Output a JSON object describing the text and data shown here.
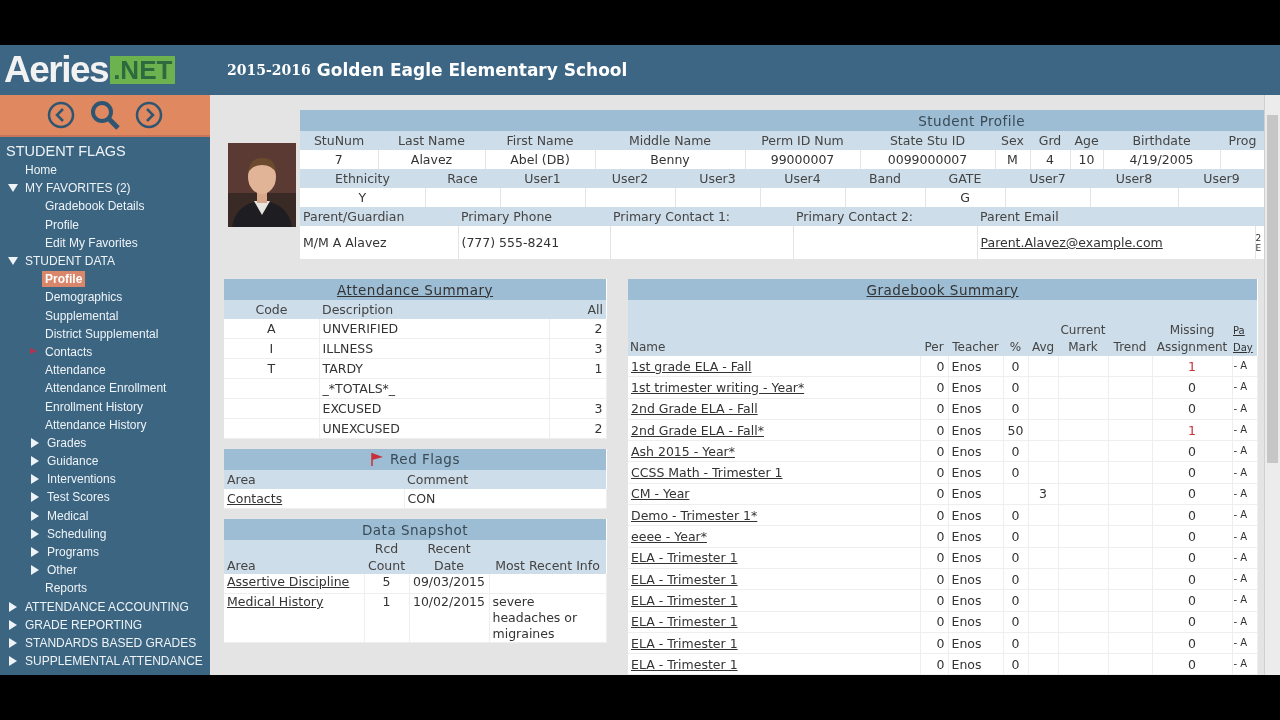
{
  "header": {
    "logo": {
      "name": "Aeries",
      "suffix": ".NET"
    },
    "year": "2015-2016",
    "school": "Golden Eagle Elementary School"
  },
  "sidebar": {
    "title": "STUDENT FLAGS",
    "items": [
      {
        "label": "Home",
        "selected": false
      },
      {
        "label": "MY FAVORITES (2)",
        "selected": false,
        "expanded": true,
        "children": [
          {
            "label": "Gradebook Details",
            "selected": false
          },
          {
            "label": "Profile",
            "selected": false
          },
          {
            "label": "Edit My Favorites",
            "selected": false
          }
        ]
      },
      {
        "label": "STUDENT DATA",
        "selected": false,
        "expanded": true,
        "children": [
          {
            "label": "Profile",
            "selected": true
          },
          {
            "label": "Demographics",
            "selected": false
          },
          {
            "label": "Supplemental",
            "selected": false
          },
          {
            "label": "District Supplemental",
            "selected": false
          },
          {
            "label": "Contacts",
            "selected": false,
            "flagged": true
          },
          {
            "label": "Attendance",
            "selected": false
          },
          {
            "label": "Attendance Enrollment",
            "selected": false
          },
          {
            "label": "Enrollment History",
            "selected": false
          },
          {
            "label": "Attendance History",
            "selected": false
          },
          {
            "label": "Grades",
            "selected": false,
            "expanded": false
          },
          {
            "label": "Guidance",
            "selected": false,
            "expanded": false
          },
          {
            "label": "Interventions",
            "selected": false,
            "expanded": false
          },
          {
            "label": "Test Scores",
            "selected": false,
            "expanded": false
          },
          {
            "label": "Medical",
            "selected": false,
            "expanded": false
          },
          {
            "label": "Scheduling",
            "selected": false,
            "expanded": false
          },
          {
            "label": "Programs",
            "selected": false,
            "expanded": false
          },
          {
            "label": "Other",
            "selected": false,
            "expanded": false
          },
          {
            "label": "Reports",
            "selected": false
          }
        ]
      },
      {
        "label": "ATTENDANCE ACCOUNTING",
        "selected": false,
        "expanded": false
      },
      {
        "label": "GRADE REPORTING",
        "selected": false,
        "expanded": false
      },
      {
        "label": "STANDARDS BASED GRADES",
        "selected": false,
        "expanded": false
      },
      {
        "label": "SUPPLEMENTAL ATTENDANCE",
        "selected": false,
        "expanded": false
      }
    ]
  },
  "profile": {
    "title": "Student Profile",
    "sections": [
      {
        "columns": [
          {
            "header": "StuNum",
            "value": "7"
          },
          {
            "header": "Last Name",
            "value": "Alavez"
          },
          {
            "header": "First Name",
            "value": "Abel (DB)"
          },
          {
            "header": "Middle Name",
            "value": "Benny"
          },
          {
            "header": "Perm ID Num",
            "value": "99000007"
          },
          {
            "header": "State Stu ID",
            "value": "0099000007"
          },
          {
            "header": "Sex",
            "value": "M"
          },
          {
            "header": "Grd",
            "value": "4"
          },
          {
            "header": "Age",
            "value": "10"
          },
          {
            "header": "Birthdate",
            "value": "4/19/2005"
          },
          {
            "header": "Prog"
          }
        ]
      },
      {
        "columns": [
          {
            "header": "Ethnicity",
            "value": "Y"
          },
          {
            "header": "Race"
          },
          {
            "header": "User1"
          },
          {
            "header": "User2"
          },
          {
            "header": "User3"
          },
          {
            "header": "User4"
          },
          {
            "header": "Band"
          },
          {
            "header": "GATE",
            "value": "G"
          },
          {
            "header": "User7"
          },
          {
            "header": "User8"
          },
          {
            "header": "User9"
          }
        ]
      },
      {
        "columns": [
          {
            "header": "Parent/Guardian",
            "value": "M/M A Alavez"
          },
          {
            "header": "Primary Phone",
            "value": "(777) 555-8241"
          },
          {
            "header": "Primary Contact 1:"
          },
          {
            "header": "Primary Contact 2:"
          },
          {
            "header": "Parent Email",
            "value": "Parent.Alavez@example.com"
          },
          {
            "value": "2 E"
          }
        ]
      }
    ]
  },
  "attendance": {
    "title": "Attendance Summary",
    "columns": [
      "Code",
      "Description",
      "All"
    ],
    "rows": [
      {
        "code": "A",
        "description": "UNVERIFIED",
        "all": "2"
      },
      {
        "code": "I",
        "description": "ILLNESS",
        "all": "3"
      },
      {
        "code": "T",
        "description": "TARDY",
        "all": "1"
      },
      {
        "description": "_*TOTALS*_"
      },
      {
        "description": "EXCUSED",
        "all": "3"
      },
      {
        "description": "UNEXCUSED",
        "all": "2"
      }
    ]
  },
  "red_flags": {
    "title": "Red Flags",
    "columns": [
      "Area",
      "Comment"
    ],
    "rows": [
      {
        "area": "Contacts",
        "comment": "CON"
      }
    ]
  },
  "snapshot": {
    "title": "Data Snapshot",
    "columns": [
      "Area",
      "Rcd Count",
      "Recent Date",
      "Most Recent Info"
    ],
    "rows": [
      {
        "area": "Assertive Discipline",
        "count": "5",
        "date": "09/03/2015"
      },
      {
        "area": "Medical History",
        "count": "1",
        "date": "10/02/2015",
        "info": "severe headaches or migraines"
      }
    ]
  },
  "gradebook": {
    "title": "Gradebook Summary",
    "columns": [
      "Name",
      "Per",
      "Teacher",
      "%",
      "Avg",
      "Current Mark",
      "Trend",
      "Missing Assignment",
      "Pa Day"
    ],
    "rows": [
      {
        "name": "1st grade ELA - Fall",
        "per": "0",
        "teacher": "Enos",
        "pct": "0",
        "missing": "1",
        "alert": true,
        "last": "- A"
      },
      {
        "name": "1st trimester writing - Year*",
        "per": "0",
        "teacher": "Enos",
        "pct": "0",
        "missing": "0",
        "alert": false,
        "last": "- A"
      },
      {
        "name": "2nd Grade ELA - Fall",
        "per": "0",
        "teacher": "Enos",
        "pct": "0",
        "missing": "0",
        "alert": false,
        "last": "- A"
      },
      {
        "name": "2nd Grade ELA - Fall*",
        "per": "0",
        "teacher": "Enos",
        "pct": "50",
        "missing": "1",
        "alert": true,
        "last": "- A"
      },
      {
        "name": "Ash 2015 - Year*",
        "per": "0",
        "teacher": "Enos",
        "pct": "0",
        "missing": "0",
        "alert": false,
        "last": "- A"
      },
      {
        "name": "CCSS Math - Trimester 1",
        "per": "0",
        "teacher": "Enos",
        "pct": "0",
        "missing": "0",
        "alert": false,
        "last": "- A"
      },
      {
        "name": "CM - Year",
        "per": "0",
        "teacher": "Enos",
        "avg": "3",
        "missing": "0",
        "alert": false,
        "last": "- A"
      },
      {
        "name": "Demo - Trimester 1*",
        "per": "0",
        "teacher": "Enos",
        "pct": "0",
        "missing": "0",
        "alert": false,
        "last": "- A"
      },
      {
        "name": "eeee - Year*",
        "per": "0",
        "teacher": "Enos",
        "pct": "0",
        "missing": "0",
        "alert": false,
        "last": "- A"
      },
      {
        "name": "ELA - Trimester 1",
        "per": "0",
        "teacher": "Enos",
        "pct": "0",
        "missing": "0",
        "alert": false,
        "last": "- A"
      },
      {
        "name": "ELA - Trimester 1",
        "per": "0",
        "teacher": "Enos",
        "pct": "0",
        "missing": "0",
        "alert": false,
        "last": "- A"
      },
      {
        "name": "ELA - Trimester 1",
        "per": "0",
        "teacher": "Enos",
        "pct": "0",
        "missing": "0",
        "alert": false,
        "last": "- A"
      },
      {
        "name": "ELA - Trimester 1",
        "per": "0",
        "teacher": "Enos",
        "pct": "0",
        "missing": "0",
        "alert": false,
        "last": "- A"
      },
      {
        "name": "ELA - Trimester 1",
        "per": "0",
        "teacher": "Enos",
        "pct": "0",
        "missing": "0",
        "alert": false,
        "last": "- A"
      },
      {
        "name": "ELA - Trimester 1",
        "per": "0",
        "teacher": "Enos",
        "pct": "0",
        "missing": "0",
        "alert": false,
        "last": "- A"
      }
    ]
  }
}
